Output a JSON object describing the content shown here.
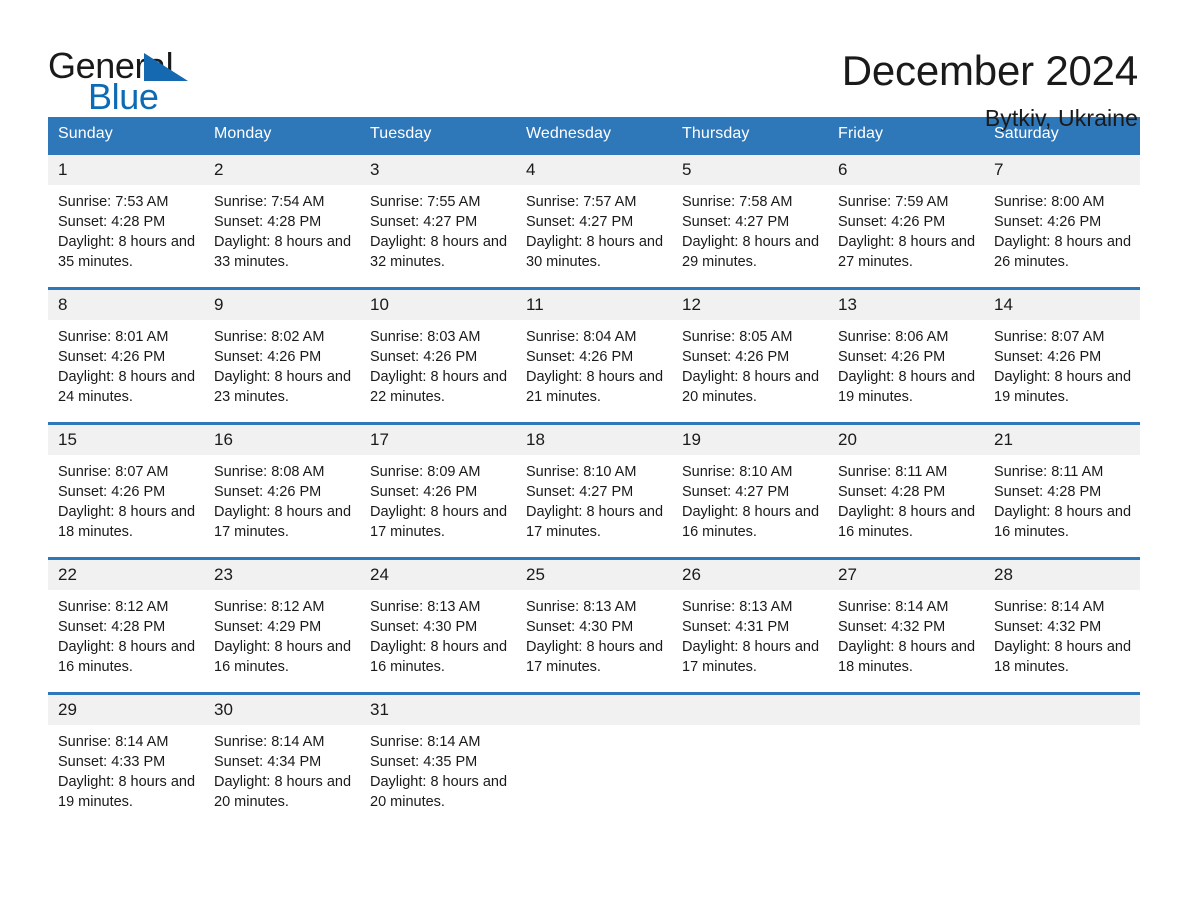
{
  "logo": {
    "word_one": "General",
    "word_two": "Blue",
    "triangle_color": "#1569b0",
    "blue_text_color": "#0d6bb5"
  },
  "header": {
    "title": "December 2024",
    "location": "Bytkiv, Ukraine"
  },
  "theme": {
    "header_blue": "#2e77b8",
    "daynum_band": "#f1f1f1",
    "text": "#1a1a1a",
    "page_background": "#ffffff"
  },
  "calendar": {
    "weekday_headers": [
      "Sunday",
      "Monday",
      "Tuesday",
      "Wednesday",
      "Thursday",
      "Friday",
      "Saturday"
    ],
    "weeks": [
      [
        {
          "day": "1",
          "sunrise": "Sunrise: 7:53 AM",
          "sunset": "Sunset: 4:28 PM",
          "daylight": "Daylight: 8 hours and 35 minutes."
        },
        {
          "day": "2",
          "sunrise": "Sunrise: 7:54 AM",
          "sunset": "Sunset: 4:28 PM",
          "daylight": "Daylight: 8 hours and 33 minutes."
        },
        {
          "day": "3",
          "sunrise": "Sunrise: 7:55 AM",
          "sunset": "Sunset: 4:27 PM",
          "daylight": "Daylight: 8 hours and 32 minutes."
        },
        {
          "day": "4",
          "sunrise": "Sunrise: 7:57 AM",
          "sunset": "Sunset: 4:27 PM",
          "daylight": "Daylight: 8 hours and 30 minutes."
        },
        {
          "day": "5",
          "sunrise": "Sunrise: 7:58 AM",
          "sunset": "Sunset: 4:27 PM",
          "daylight": "Daylight: 8 hours and 29 minutes."
        },
        {
          "day": "6",
          "sunrise": "Sunrise: 7:59 AM",
          "sunset": "Sunset: 4:26 PM",
          "daylight": "Daylight: 8 hours and 27 minutes."
        },
        {
          "day": "7",
          "sunrise": "Sunrise: 8:00 AM",
          "sunset": "Sunset: 4:26 PM",
          "daylight": "Daylight: 8 hours and 26 minutes."
        }
      ],
      [
        {
          "day": "8",
          "sunrise": "Sunrise: 8:01 AM",
          "sunset": "Sunset: 4:26 PM",
          "daylight": "Daylight: 8 hours and 24 minutes."
        },
        {
          "day": "9",
          "sunrise": "Sunrise: 8:02 AM",
          "sunset": "Sunset: 4:26 PM",
          "daylight": "Daylight: 8 hours and 23 minutes."
        },
        {
          "day": "10",
          "sunrise": "Sunrise: 8:03 AM",
          "sunset": "Sunset: 4:26 PM",
          "daylight": "Daylight: 8 hours and 22 minutes."
        },
        {
          "day": "11",
          "sunrise": "Sunrise: 8:04 AM",
          "sunset": "Sunset: 4:26 PM",
          "daylight": "Daylight: 8 hours and 21 minutes."
        },
        {
          "day": "12",
          "sunrise": "Sunrise: 8:05 AM",
          "sunset": "Sunset: 4:26 PM",
          "daylight": "Daylight: 8 hours and 20 minutes."
        },
        {
          "day": "13",
          "sunrise": "Sunrise: 8:06 AM",
          "sunset": "Sunset: 4:26 PM",
          "daylight": "Daylight: 8 hours and 19 minutes."
        },
        {
          "day": "14",
          "sunrise": "Sunrise: 8:07 AM",
          "sunset": "Sunset: 4:26 PM",
          "daylight": "Daylight: 8 hours and 19 minutes."
        }
      ],
      [
        {
          "day": "15",
          "sunrise": "Sunrise: 8:07 AM",
          "sunset": "Sunset: 4:26 PM",
          "daylight": "Daylight: 8 hours and 18 minutes."
        },
        {
          "day": "16",
          "sunrise": "Sunrise: 8:08 AM",
          "sunset": "Sunset: 4:26 PM",
          "daylight": "Daylight: 8 hours and 17 minutes."
        },
        {
          "day": "17",
          "sunrise": "Sunrise: 8:09 AM",
          "sunset": "Sunset: 4:26 PM",
          "daylight": "Daylight: 8 hours and 17 minutes."
        },
        {
          "day": "18",
          "sunrise": "Sunrise: 8:10 AM",
          "sunset": "Sunset: 4:27 PM",
          "daylight": "Daylight: 8 hours and 17 minutes."
        },
        {
          "day": "19",
          "sunrise": "Sunrise: 8:10 AM",
          "sunset": "Sunset: 4:27 PM",
          "daylight": "Daylight: 8 hours and 16 minutes."
        },
        {
          "day": "20",
          "sunrise": "Sunrise: 8:11 AM",
          "sunset": "Sunset: 4:28 PM",
          "daylight": "Daylight: 8 hours and 16 minutes."
        },
        {
          "day": "21",
          "sunrise": "Sunrise: 8:11 AM",
          "sunset": "Sunset: 4:28 PM",
          "daylight": "Daylight: 8 hours and 16 minutes."
        }
      ],
      [
        {
          "day": "22",
          "sunrise": "Sunrise: 8:12 AM",
          "sunset": "Sunset: 4:28 PM",
          "daylight": "Daylight: 8 hours and 16 minutes."
        },
        {
          "day": "23",
          "sunrise": "Sunrise: 8:12 AM",
          "sunset": "Sunset: 4:29 PM",
          "daylight": "Daylight: 8 hours and 16 minutes."
        },
        {
          "day": "24",
          "sunrise": "Sunrise: 8:13 AM",
          "sunset": "Sunset: 4:30 PM",
          "daylight": "Daylight: 8 hours and 16 minutes."
        },
        {
          "day": "25",
          "sunrise": "Sunrise: 8:13 AM",
          "sunset": "Sunset: 4:30 PM",
          "daylight": "Daylight: 8 hours and 17 minutes."
        },
        {
          "day": "26",
          "sunrise": "Sunrise: 8:13 AM",
          "sunset": "Sunset: 4:31 PM",
          "daylight": "Daylight: 8 hours and 17 minutes."
        },
        {
          "day": "27",
          "sunrise": "Sunrise: 8:14 AM",
          "sunset": "Sunset: 4:32 PM",
          "daylight": "Daylight: 8 hours and 18 minutes."
        },
        {
          "day": "28",
          "sunrise": "Sunrise: 8:14 AM",
          "sunset": "Sunset: 4:32 PM",
          "daylight": "Daylight: 8 hours and 18 minutes."
        }
      ],
      [
        {
          "day": "29",
          "sunrise": "Sunrise: 8:14 AM",
          "sunset": "Sunset: 4:33 PM",
          "daylight": "Daylight: 8 hours and 19 minutes."
        },
        {
          "day": "30",
          "sunrise": "Sunrise: 8:14 AM",
          "sunset": "Sunset: 4:34 PM",
          "daylight": "Daylight: 8 hours and 20 minutes."
        },
        {
          "day": "31",
          "sunrise": "Sunrise: 8:14 AM",
          "sunset": "Sunset: 4:35 PM",
          "daylight": "Daylight: 8 hours and 20 minutes."
        },
        {
          "day": "",
          "sunrise": "",
          "sunset": "",
          "daylight": ""
        },
        {
          "day": "",
          "sunrise": "",
          "sunset": "",
          "daylight": ""
        },
        {
          "day": "",
          "sunrise": "",
          "sunset": "",
          "daylight": ""
        },
        {
          "day": "",
          "sunrise": "",
          "sunset": "",
          "daylight": ""
        }
      ]
    ]
  }
}
